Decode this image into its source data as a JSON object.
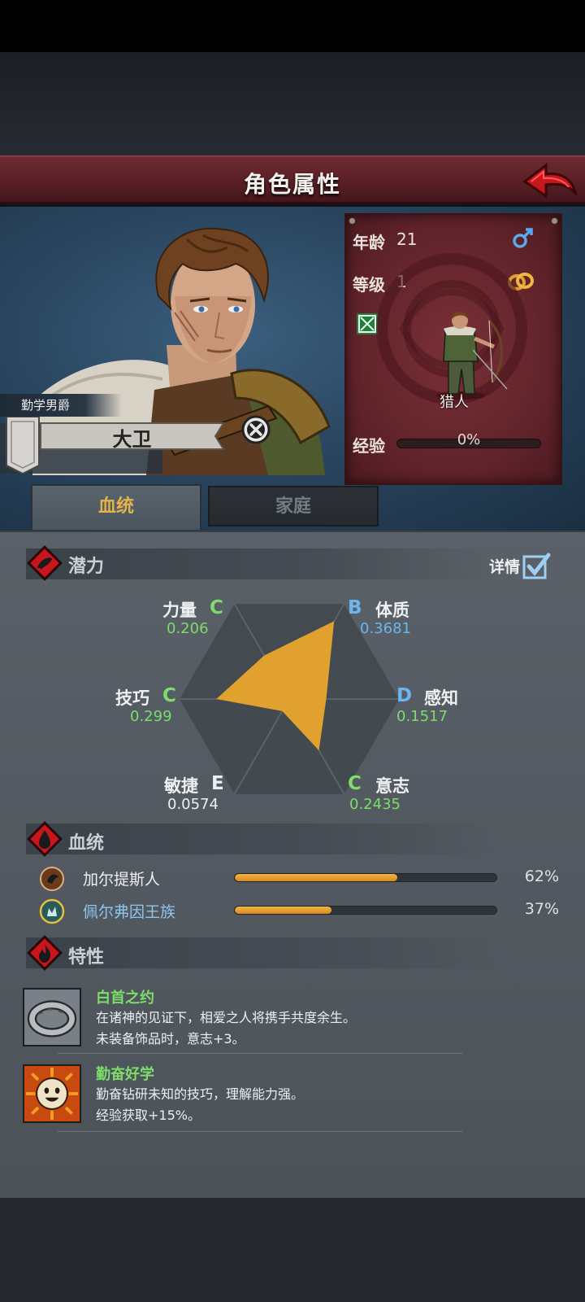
{
  "header": {
    "title": "角色属性"
  },
  "character": {
    "title": "勤学男爵",
    "name": "大卫"
  },
  "stats": {
    "age_label": "年龄",
    "age_value": "21",
    "level_label": "等级",
    "level_value": "1",
    "class_name": "猎人",
    "exp_label": "经验",
    "exp_value": "0%"
  },
  "tabs": [
    {
      "label": "血统",
      "active": true
    },
    {
      "label": "家庭",
      "active": false
    }
  ],
  "potential": {
    "title": "潜力",
    "detail_label": "详情",
    "attributes": [
      {
        "name": "力量",
        "grade": "C",
        "value": "0.206"
      },
      {
        "name": "体质",
        "grade": "B",
        "value": "0.3681"
      },
      {
        "name": "感知",
        "grade": "D",
        "value": "0.1517"
      },
      {
        "name": "意志",
        "grade": "C",
        "value": "0.2435"
      },
      {
        "name": "敏捷",
        "grade": "E",
        "value": "0.0574"
      },
      {
        "name": "技巧",
        "grade": "C",
        "value": "0.299"
      }
    ]
  },
  "bloodline": {
    "title": "血统",
    "items": [
      {
        "name": "加尔提斯人",
        "percent": "62%",
        "fill": 0.62
      },
      {
        "name": "佩尔弗因王族",
        "percent": "37%",
        "fill": 0.37
      }
    ]
  },
  "traits": {
    "title": "特性",
    "items": [
      {
        "name": "白首之约",
        "line1": "在诸神的见证下，相爱之人将携手共度余生。",
        "line2": "未装备饰品时，意志+3。"
      },
      {
        "name": "勤奋好学",
        "line1": "勤奋钻研未知的技巧，理解能力强。",
        "line2": "经验获取+15%。"
      }
    ]
  },
  "colors": {
    "grade_green": "#7ddc6a",
    "grade_blue": "#6db5ee",
    "accent_orange": "#e0a12e",
    "header_red": "#5a1f26"
  }
}
